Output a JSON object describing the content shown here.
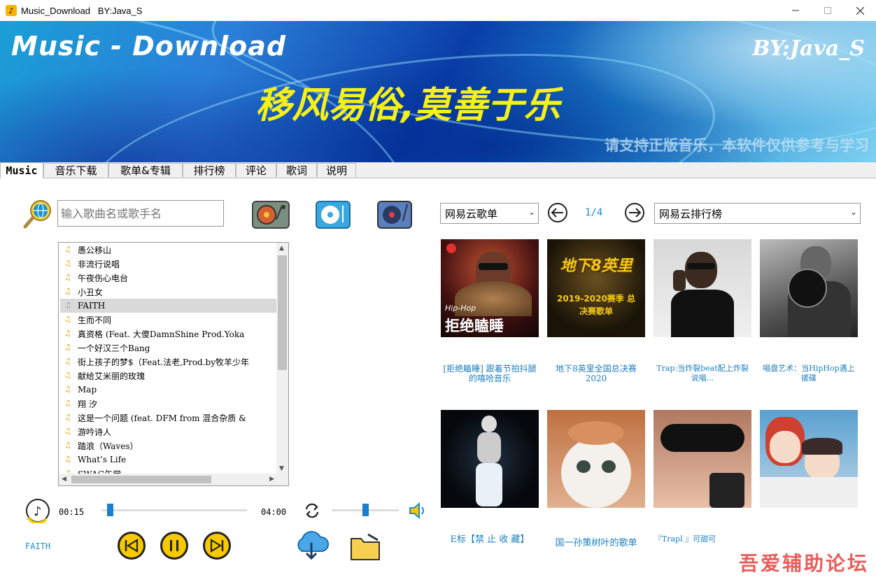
{
  "window": {
    "title": "Music_Download   BY:Java_S",
    "minimize_icon": "minimize-icon",
    "maximize_icon": "maximize-icon",
    "close_icon": "close-icon"
  },
  "banner": {
    "title": "Music - Download",
    "by": "BY:Java_S",
    "slogan": "移风易俗,莫善于乐",
    "note": "请支持正版音乐，本软件仅供参考与学习"
  },
  "tabs": [
    "Music",
    "音乐下载",
    "歌单&专辑",
    "排行榜",
    "评论",
    "歌词",
    "说明"
  ],
  "search": {
    "placeholder": "输入歌曲名或歌手名"
  },
  "songs": [
    "愚公移山",
    "非流行说唱",
    "午夜伤心电台",
    "小丑女",
    "FAITH",
    "生而不同",
    "真资格 (Feat. 大傻DamnShine Prod.Yoka",
    "一个好汉三个Bang",
    "街上孩子的梦$（Feat.法老,Prod.by牧羊少年",
    "献给艾米丽的玫瑰",
    "Map",
    "翔  汐",
    "这是一个问题 (feat. DFM from 混合杂质 &",
    "游吟诗人",
    "踏浪（Waves）",
    "What’s Life",
    "SWAG午觉"
  ],
  "selected_song": "FAITH",
  "playlist_panel": {
    "left_combo": "网易云歌单",
    "page": "1/4",
    "right_combo": "网易云排行榜",
    "cards": [
      {
        "label": "[拒绝瞌睡] 跟着节拍抖腿的嘻哈音乐",
        "img_text": "拒绝瞌睡",
        "img_sub": "Hip-Hop"
      },
      {
        "label": "地下8英里全国总决赛2020",
        "img_text": "地下8英里",
        "img_sub": "2019-2020赛季 总决赛歌单"
      },
      {
        "label": "Trap:当炸裂beat配上炸裂说唱...",
        "img_text": "",
        "img_sub": ""
      },
      {
        "label": "唱盘艺术：当HipHop遇上搓碟",
        "img_text": "",
        "img_sub": ""
      },
      {
        "label": "E标【禁 止 收 藏】",
        "img_text": "",
        "img_sub": ""
      },
      {
        "label": "国一孙策树叶的歌单",
        "img_text": "",
        "img_sub": ""
      },
      {
        "label": "『Trapl 』可甜可",
        "img_text": "",
        "img_sub": ""
      },
      {
        "label": "",
        "img_text": "",
        "img_sub": ""
      }
    ]
  },
  "player": {
    "elapsed": "00:15",
    "total": "04:00",
    "progress": 0.06,
    "volume": 0.5,
    "now_playing": "FAITH"
  },
  "watermark": "吾爱辅助论坛",
  "colors": {
    "accent": "#1a8fd0",
    "control_yellow": "#f7c900",
    "slogan_yellow": "#f5f018"
  }
}
